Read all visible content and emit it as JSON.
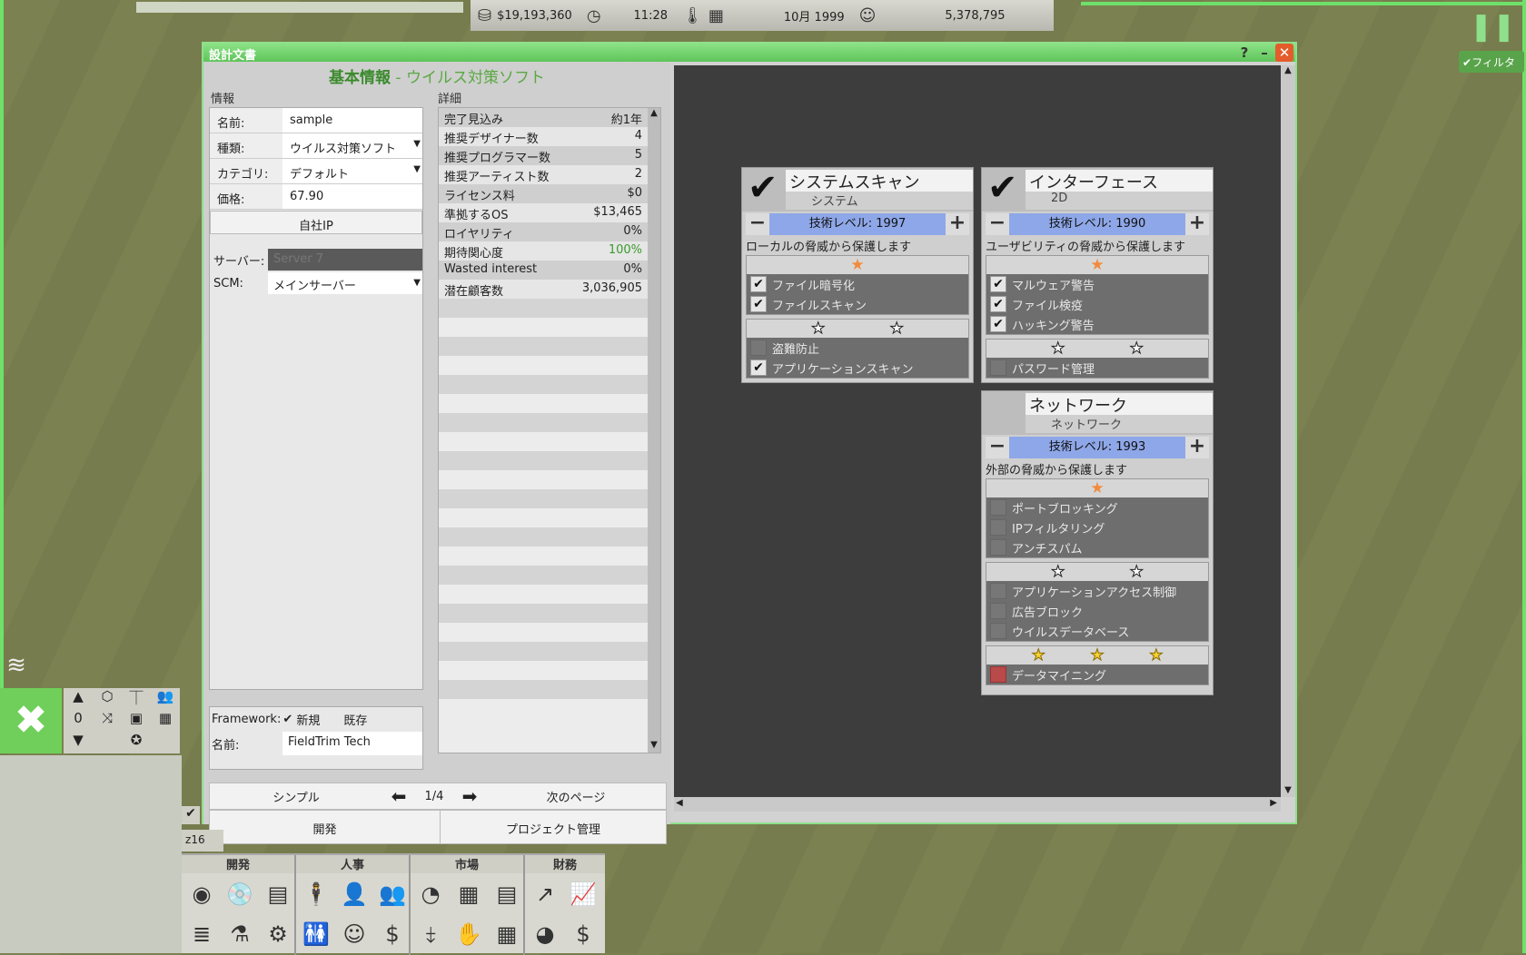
{
  "topbar": {
    "money": "$19,193,360",
    "time": "11:28",
    "date": "10月 1999",
    "fans": "5,378,795",
    "filter": "フィルタ"
  },
  "window": {
    "title": "設計文書"
  },
  "heading": {
    "main": "基本情報",
    "sub": " - ウイルス対策ソフト"
  },
  "info": {
    "label": "情報",
    "name_label": "名前:",
    "name_value": "sample",
    "type_label": "種類:",
    "type_value": "ウイルス対策ソフト",
    "category_label": "カテゴリ:",
    "category_value": "デフォルト",
    "price_label": "価格:",
    "price_value": "67.90",
    "own_ip": "自社IP",
    "server_label": "サーバー:",
    "server_value": "Server 7",
    "scm_label": "SCM:",
    "scm_value": "メインサーバー"
  },
  "framework": {
    "label": "Framework:",
    "new": "新規",
    "existing": "既存",
    "name_label": "名前:",
    "name_value": "FieldTrim Tech"
  },
  "details": {
    "label": "詳細",
    "rows": [
      {
        "k": "完了見込み",
        "v": "約1年"
      },
      {
        "k": "推奨デザイナー数",
        "v": "4"
      },
      {
        "k": "推奨プログラマー数",
        "v": "5"
      },
      {
        "k": "推奨アーティスト数",
        "v": "2"
      },
      {
        "k": "ライセンス料",
        "v": "$0"
      },
      {
        "k": "準拠するOS",
        "v": "$13,465"
      },
      {
        "k": "ロイヤリティ",
        "v": "0%"
      },
      {
        "k": "期待関心度",
        "v": "100%"
      },
      {
        "k": "Wasted interest",
        "v": "0%"
      },
      {
        "k": "潜在顧客数",
        "v": "3,036,905"
      }
    ]
  },
  "nav": {
    "simple": "シンプル",
    "page": "1/4",
    "next": "次のページ",
    "develop": "開発",
    "project": "プロジェクト管理"
  },
  "cards": {
    "system": {
      "name": "システムスキャン",
      "cat": "システム",
      "level": "技術レベル: 1997",
      "desc": "ローカルの脅威から保護します",
      "t1": [
        "ファイル暗号化",
        "ファイルスキャン"
      ],
      "t2": [
        "盗難防止",
        "アプリケーションスキャン"
      ]
    },
    "interface": {
      "name": "インターフェース",
      "cat": "2D",
      "level": "技術レベル: 1990",
      "desc": "ユーザビリティの脅威から保護します",
      "t1": [
        "マルウェア警告",
        "ファイル検疫",
        "ハッキング警告"
      ],
      "t2": [
        "パスワード管理"
      ]
    },
    "network": {
      "name": "ネットワーク",
      "cat": "ネットワーク",
      "level": "技術レベル: 1993",
      "desc": "外部の脅威から保護します",
      "t1": [
        "ポートブロッキング",
        "IPフィルタリング",
        "アンチスパム"
      ],
      "t2": [
        "アプリケーションアクセス制御",
        "広告ブロック",
        "ウイルスデータベース"
      ],
      "t3": [
        "データマイニング"
      ]
    }
  },
  "bottom": {
    "dev": "開発",
    "hr": "人事",
    "market": "市場",
    "finance": "財務",
    "count": "16",
    "zero": "0"
  },
  "colors": {
    "accent": "#6fe06a",
    "title_green": "#3a8a2c",
    "level_bar": "#8ea7e8",
    "close": "#e45c2b"
  }
}
